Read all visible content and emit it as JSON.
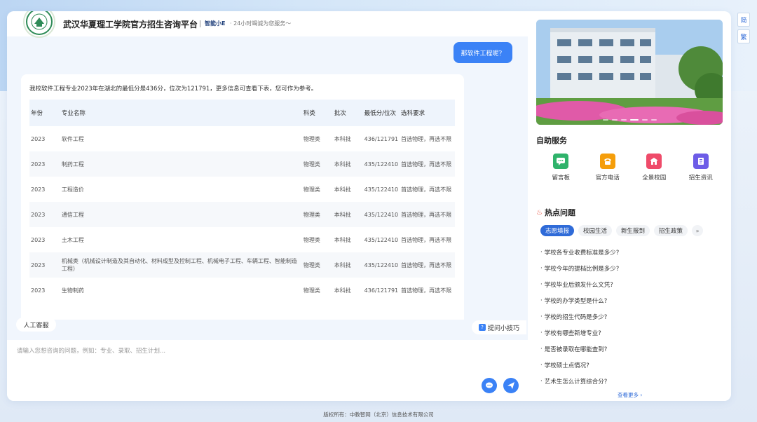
{
  "lang": {
    "simplified": "简",
    "traditional": "繁"
  },
  "header": {
    "logo_text": "武汉华夏",
    "title": "武汉华夏理工学院官方招生咨询平台",
    "assistant": "智能小E",
    "slogan": "· 24小时竭诚为您服务～"
  },
  "chat": {
    "user_message": "那软件工程呢？",
    "bot_intro": "我校软件工程专业2023年在湖北的最低分是436分，位次为121791，更多信息可查看下表，您可作为参考。",
    "table": {
      "headers": [
        "年份",
        "专业名称",
        "科类",
        "批次",
        "最低分/位次",
        "选科要求"
      ],
      "rows": [
        [
          "2023",
          "软件工程",
          "物理类",
          "本科批",
          "436/121791",
          "首选物理，再选不限"
        ],
        [
          "2023",
          "制药工程",
          "物理类",
          "本科批",
          "435/122410",
          "首选物理，再选不限"
        ],
        [
          "2023",
          "工程造价",
          "物理类",
          "本科批",
          "435/122410",
          "首选物理，再选不限"
        ],
        [
          "2023",
          "通信工程",
          "物理类",
          "本科批",
          "435/122410",
          "首选物理，再选不限"
        ],
        [
          "2023",
          "土木工程",
          "物理类",
          "本科批",
          "435/122410",
          "首选物理，再选不限"
        ],
        [
          "2023",
          "机械类（机械设计制造及其自动化、材料成型及控制工程、机械电子工程、车辆工程、智能制造工程）",
          "物理类",
          "本科批",
          "435/122410",
          "首选物理，再选不限"
        ],
        [
          "2023",
          "生物制药",
          "物理类",
          "本科批",
          "436/121791",
          "首选物理，再选不限"
        ]
      ]
    },
    "manual_service": "人工客服",
    "tips": "提问小技巧",
    "input_placeholder": "请输入您想咨询的问题，例如：专业、录取、招生计划..."
  },
  "side": {
    "self_service_title": "自助服务",
    "services": [
      {
        "label": "留言板",
        "icon": "message-board-icon",
        "color": "#2fb36b"
      },
      {
        "label": "官方电话",
        "icon": "phone-icon",
        "color": "#f59e0b"
      },
      {
        "label": "全景校园",
        "icon": "campus-icon",
        "color": "#ef4b6a"
      },
      {
        "label": "招生资讯",
        "icon": "news-icon",
        "color": "#6d5ce7"
      }
    ],
    "hot_title": "热点问题",
    "hot_tabs": [
      "志愿填报",
      "校园生活",
      "新生报到",
      "招生政策"
    ],
    "hot_questions": [
      "学校各专业收费标准是多少?",
      "学校今年的提档比例是多少?",
      "学校毕业后颁发什么文凭?",
      "学校的办学类型是什么?",
      "学校的招生代码是多少?",
      "学校有哪些新增专业?",
      "是否被录取在哪能查到?",
      "学校硕士点情况?",
      "艺术生怎么计算综合分?"
    ],
    "see_more": "查看更多 ›"
  },
  "footer": "版权所有：中教智网（北京）信息技术有限公司"
}
